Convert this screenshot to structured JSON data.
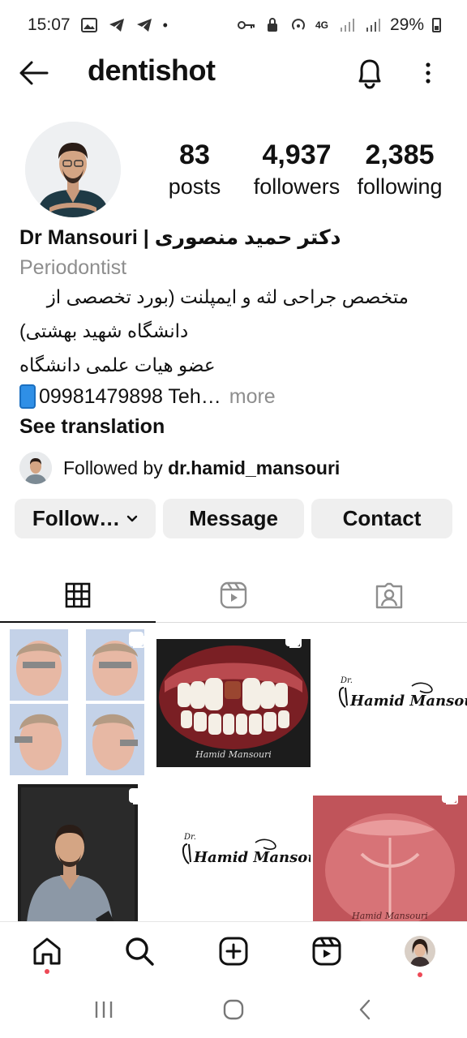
{
  "status_bar": {
    "time": "15:07",
    "network": "4G",
    "battery": "29%"
  },
  "header": {
    "username": "dentishot"
  },
  "profile": {
    "stats": [
      {
        "value": "83",
        "label": "posts"
      },
      {
        "value": "4,937",
        "label": "followers"
      },
      {
        "value": "2,385",
        "label": "following"
      }
    ],
    "name": "Dr Mansouri | دکتر حمید منصوری",
    "category": "Periodontist",
    "bio_lines": [
      "متخصص جراحی لثه و ایمپلنت (بورد تخصصی از",
      "دانشگاه شهید بهشتی)",
      "عضو هیات علمی دانشگاه"
    ],
    "contact_text": "09981479898  Teh…",
    "more_label": "more",
    "see_translation": "See translation",
    "followed_by_prefix": "Followed by ",
    "followed_by_user": "dr.hamid_mansouri"
  },
  "actions": {
    "follow": "Follow…",
    "message": "Message",
    "contact": "Contact"
  },
  "grid": {
    "logo_dr": "Dr.",
    "logo_name": "Hamid Mansouri",
    "watermark": "Hamid Mansouri"
  },
  "colors": {
    "notification_dot": "#ed4956",
    "button_bg": "#efefef",
    "secondary_text": "#8e8e8e"
  }
}
